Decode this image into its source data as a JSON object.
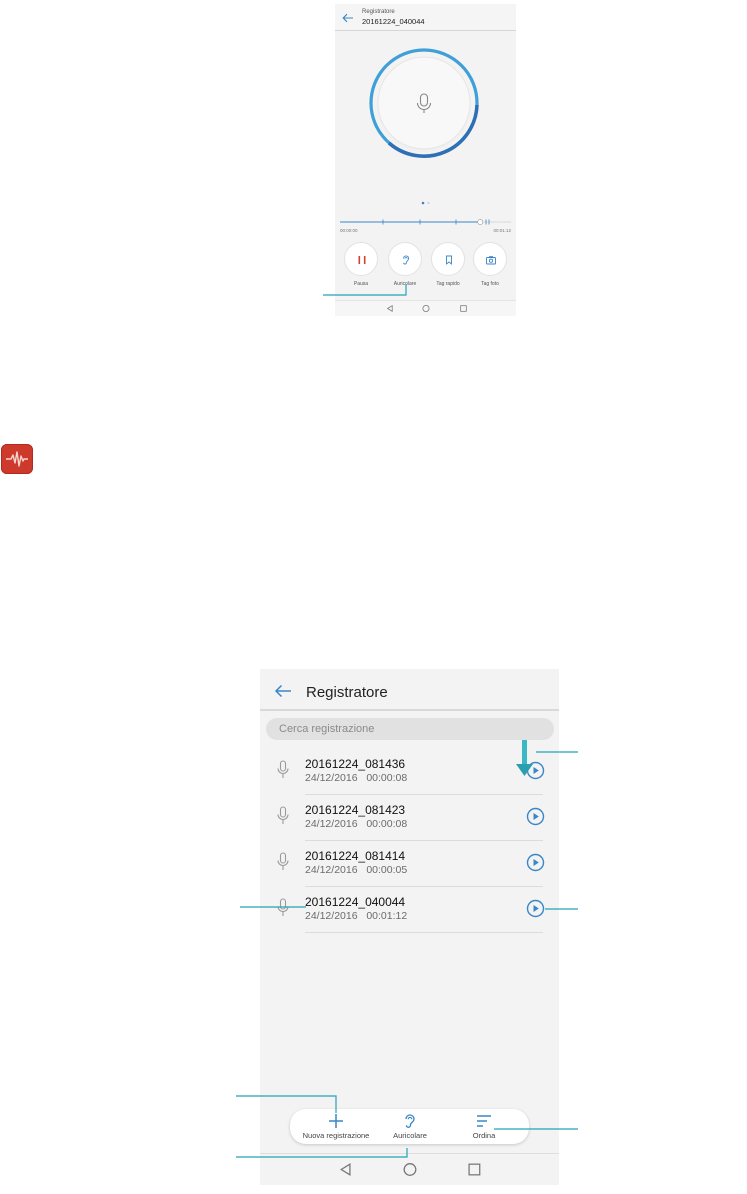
{
  "colors": {
    "accent_blue": "#3a86c8",
    "callout_teal": "#23a3b5",
    "pause_red": "#d0412f",
    "app_icon_red": "#cd3a2c"
  },
  "recording_screen": {
    "app_name": "Registratore",
    "file_name": "20161224_040044",
    "time_elapsed": "00:00:00",
    "time_total": "00:01:12",
    "progress": 0.82,
    "controls": [
      {
        "label": "Pausa",
        "icon": "pause-icon"
      },
      {
        "label": "Auricolare",
        "icon": "ear-icon"
      },
      {
        "label": "Tag rapido",
        "icon": "bookmark-icon"
      },
      {
        "label": "Tag foto",
        "icon": "camera-icon"
      }
    ]
  },
  "list_screen": {
    "title": "Registratore",
    "search_placeholder": "Cerca registrazione",
    "recordings": [
      {
        "name": "20161224_081436",
        "date": "24/12/2016",
        "duration": "00:00:08"
      },
      {
        "name": "20161224_081423",
        "date": "24/12/2016",
        "duration": "00:00:08"
      },
      {
        "name": "20161224_081414",
        "date": "24/12/2016",
        "duration": "00:00:05"
      },
      {
        "name": "20161224_040044",
        "date": "24/12/2016",
        "duration": "00:01:12"
      }
    ],
    "toolbar": [
      {
        "label": "Nuova registrazione",
        "icon": "plus-icon"
      },
      {
        "label": "Auricolare",
        "icon": "ear-icon"
      },
      {
        "label": "Ordina",
        "icon": "sort-icon"
      }
    ]
  }
}
